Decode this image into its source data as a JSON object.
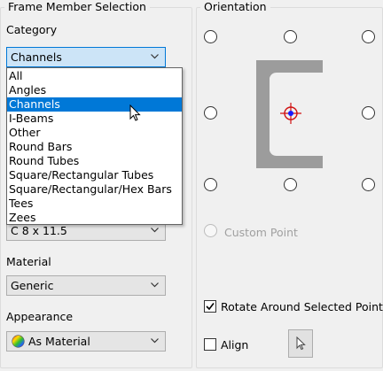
{
  "frame_member_selection": {
    "title": "Frame Member Selection",
    "category_label": "Category",
    "category_value": "Channels",
    "category_options": [
      "All",
      "Angles",
      "Channels",
      "I-Beams",
      "Other",
      "Round Bars",
      "Round Tubes",
      "Square/Rectangular Tubes",
      "Square/Rectangular/Hex Bars",
      "Tees",
      "Zees"
    ],
    "selected_index": 2,
    "size_value": "C 8 x 11.5",
    "material_label": "Material",
    "material_value": "Generic",
    "appearance_label": "Appearance",
    "appearance_value": "As Material"
  },
  "orientation": {
    "title": "Orientation",
    "custom_point_label": "Custom Point",
    "rotate_label": "Rotate Around Selected Point",
    "rotate_checked": true,
    "align_label": "Align",
    "align_checked": false
  },
  "colors": {
    "selection": "#0078d7",
    "profile_fill": "#9c9c9c",
    "target_center": "#1a1aff",
    "target_crosshair": "#d01010"
  },
  "icons": [
    "chevron-down-icon",
    "appearance-sphere-icon",
    "channel-profile-icon",
    "insertion-point-icon",
    "cursor-arrow-icon",
    "checkmark-icon"
  ]
}
